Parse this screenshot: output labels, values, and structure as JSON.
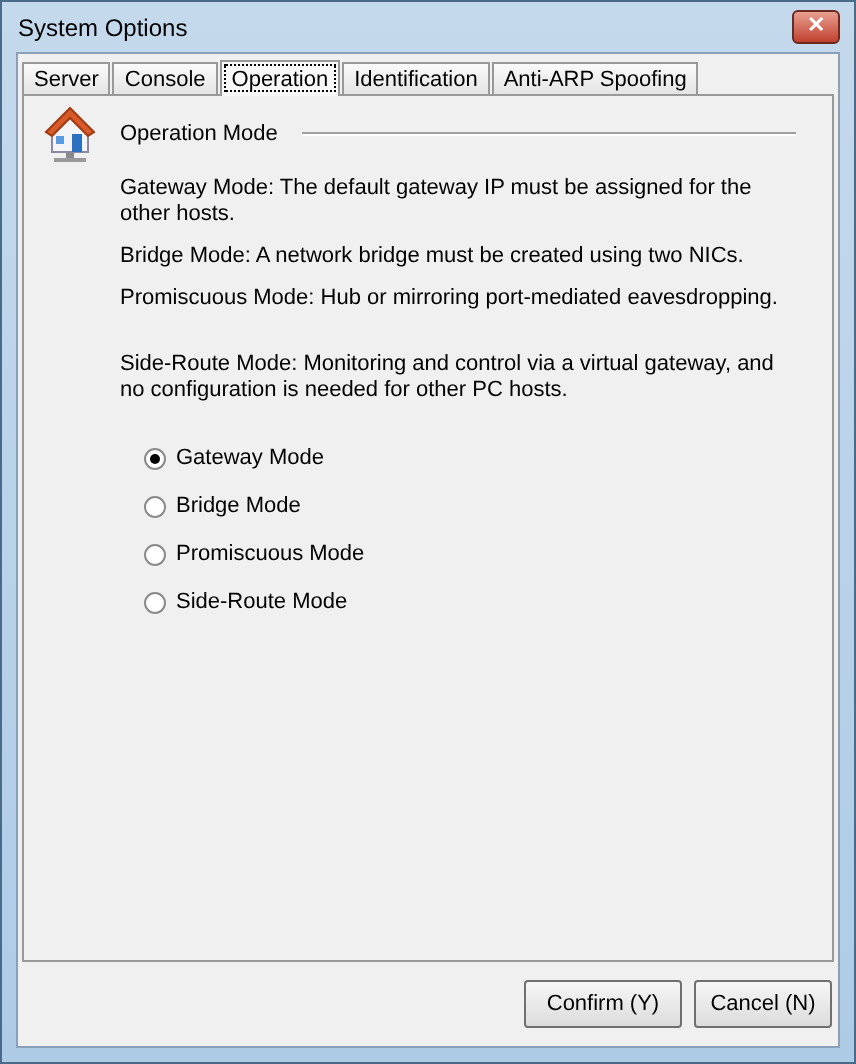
{
  "window": {
    "title": "System Options",
    "close": "✕"
  },
  "tabs": [
    {
      "label": "Server",
      "selected": false
    },
    {
      "label": "Console",
      "selected": false
    },
    {
      "label": "Operation",
      "selected": true
    },
    {
      "label": "Identification",
      "selected": false
    },
    {
      "label": "Anti-ARP Spoofing",
      "selected": false
    }
  ],
  "section": {
    "title": "Operation Mode"
  },
  "descriptions": [
    "Gateway Mode: The default gateway IP must be assigned for the other hosts.",
    "Bridge Mode: A network bridge must be created using two NICs.",
    "Promiscuous Mode: Hub or mirroring port-mediated eavesdropping.",
    "Side-Route Mode: Monitoring and control via a virtual gateway, and no configuration is needed for other PC hosts."
  ],
  "modes": [
    {
      "label": "Gateway Mode",
      "selected": true
    },
    {
      "label": "Bridge Mode",
      "selected": false
    },
    {
      "label": "Promiscuous Mode",
      "selected": false
    },
    {
      "label": "Side-Route Mode",
      "selected": false
    }
  ],
  "buttons": [
    "Confirm (Y)",
    "Cancel (N)"
  ]
}
